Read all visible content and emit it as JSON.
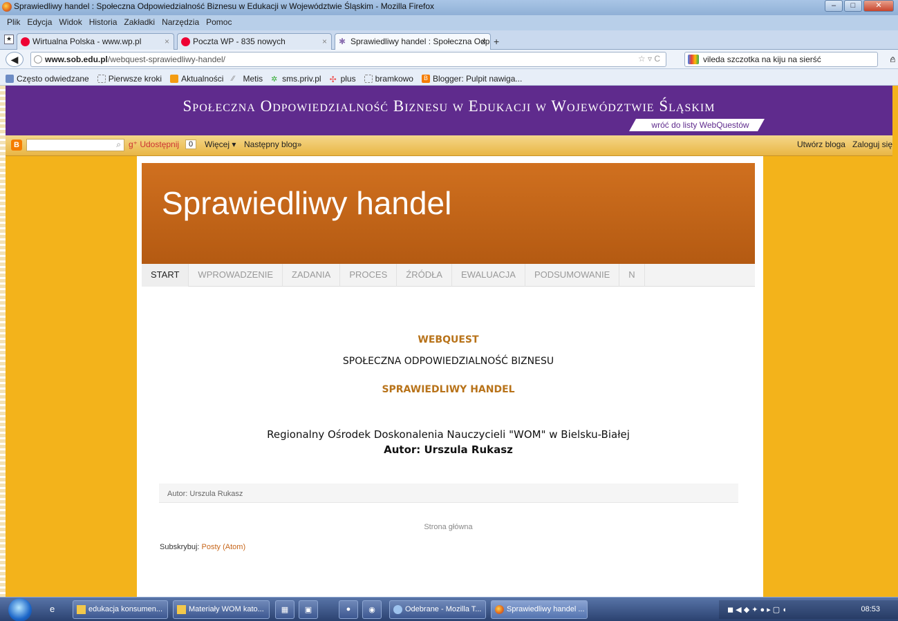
{
  "window": {
    "title": "Sprawiedliwy handel : Społeczna Odpowiedzialność Biznesu w Edukacji w Województwie Śląskim - Mozilla Firefox"
  },
  "menu": [
    "Plik",
    "Edycja",
    "Widok",
    "Historia",
    "Zakładki",
    "Narzędzia",
    "Pomoc"
  ],
  "tabs": [
    {
      "label": "Wirtualna Polska - www.wp.pl",
      "active": false
    },
    {
      "label": "Poczta WP - 835 nowych",
      "active": false
    },
    {
      "label": "Sprawiedliwy handel : Społeczna Odp...",
      "active": true
    }
  ],
  "address": {
    "url_domain": "www.sob.edu.pl",
    "url_path": "/webquest-sprawiedliwy-handel/",
    "search": "vileda szczotka na kiju na sierść"
  },
  "bookmarks": [
    "Często odwiedzane",
    "Pierwsze kroki",
    "Aktualności",
    "Metis",
    "sms.priv.pl",
    "plus",
    "bramkowo",
    "Blogger: Pulpit nawiga..."
  ],
  "site_banner": {
    "title": "Społeczna Odpowiedzialność Biznesu w Edukacji w Województwie Śląskim",
    "back_link": "wróć do listy WebQuestów"
  },
  "blogger_bar": {
    "share": "Udostępnij",
    "count": "0",
    "more": "Więcej ▾",
    "next": "Następny blog»",
    "create": "Utwórz bloga",
    "login": "Zaloguj się"
  },
  "blog": {
    "title": "Sprawiedliwy handel",
    "nav": [
      "START",
      "WPROWADZENIE",
      "ZADANIA",
      "PROCES",
      "ŹRÓDŁA",
      "EWALUACJA",
      "PODSUMOWANIE",
      "N"
    ],
    "heading1": "WEBQUEST",
    "heading2": "SPOŁECZNA ODPOWIEDZIALNOŚĆ BIZNESU",
    "heading3": "SPRAWIEDLIWY HANDEL",
    "institution": "Regionalny Ośrodek Doskonalenia Nauczycieli \"WOM\" w Bielsku-Białej",
    "author": "Autor: Urszula Rukasz",
    "author_footer": "Autor: Urszula Rukasz",
    "home": "Strona główna",
    "subscribe_label": "Subskrybuj:",
    "subscribe_link": "Posty (Atom)"
  },
  "taskbar": {
    "items": [
      "edukacja konsumen...",
      "Materiały WOM kato...",
      "Odebrane - Mozilla T...",
      "Sprawiedliwy handel ..."
    ],
    "time": "08:53"
  },
  "colors": {
    "banner": "#5f2b8d",
    "header": "#c7661a",
    "accent": "#b8731a"
  }
}
